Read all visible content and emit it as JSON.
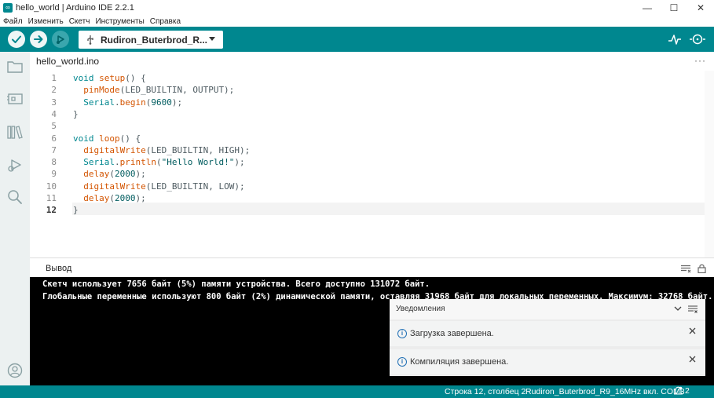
{
  "window": {
    "title": "hello_world | Arduino IDE 2.2.1",
    "controls": {
      "minimize": "—",
      "maximize": "☐",
      "close": "✕"
    }
  },
  "menu": [
    "Файл",
    "Изменить",
    "Скетч",
    "Инструменты",
    "Справка"
  ],
  "toolbar": {
    "board": "Rudiron_Buterbrod_R...",
    "icons": [
      "verify-icon",
      "upload-icon",
      "debugger-icon",
      "serial-plotter-icon",
      "serial-monitor-icon"
    ]
  },
  "sidebar": {
    "icons": [
      "sketchbook-icon",
      "boards-manager-icon",
      "library-manager-icon",
      "debug-icon",
      "search-icon",
      "account-icon"
    ]
  },
  "tab": {
    "label": "hello_world.ino",
    "more": "···"
  },
  "editor": {
    "active_line": 12,
    "lines": [
      {
        "n": "1",
        "tokens": [
          [
            "kw",
            "void "
          ],
          [
            "fn",
            "setup"
          ],
          [
            "",
            "() {"
          ]
        ]
      },
      {
        "n": "2",
        "tokens": [
          [
            "",
            "  "
          ],
          [
            "fn",
            "pinMode"
          ],
          [
            "",
            "(LED_BUILTIN, OUTPUT);"
          ]
        ]
      },
      {
        "n": "3",
        "tokens": [
          [
            "",
            "  "
          ],
          [
            "kw",
            "Serial"
          ],
          [
            "",
            "."
          ],
          [
            "fn",
            "begin"
          ],
          [
            "",
            "("
          ],
          [
            "num",
            "9600"
          ],
          [
            "",
            ");"
          ]
        ]
      },
      {
        "n": "4",
        "tokens": [
          [
            "",
            "}"
          ]
        ]
      },
      {
        "n": "5",
        "tokens": []
      },
      {
        "n": "6",
        "tokens": [
          [
            "kw",
            "void "
          ],
          [
            "fn",
            "loop"
          ],
          [
            "",
            "() {"
          ]
        ]
      },
      {
        "n": "7",
        "tokens": [
          [
            "",
            "  "
          ],
          [
            "fn",
            "digitalWrite"
          ],
          [
            "",
            "(LED_BUILTIN, HIGH);"
          ]
        ]
      },
      {
        "n": "8",
        "tokens": [
          [
            "",
            "  "
          ],
          [
            "kw",
            "Serial"
          ],
          [
            "",
            "."
          ],
          [
            "fn",
            "println"
          ],
          [
            "",
            "("
          ],
          [
            "str",
            "\"Hello World!\""
          ],
          [
            "",
            ");"
          ]
        ]
      },
      {
        "n": "9",
        "tokens": [
          [
            "",
            "  "
          ],
          [
            "fn",
            "delay"
          ],
          [
            "",
            "("
          ],
          [
            "num",
            "2000"
          ],
          [
            "",
            ");"
          ]
        ]
      },
      {
        "n": "10",
        "tokens": [
          [
            "",
            "  "
          ],
          [
            "fn",
            "digitalWrite"
          ],
          [
            "",
            "(LED_BUILTIN, LOW);"
          ]
        ]
      },
      {
        "n": "11",
        "tokens": [
          [
            "",
            "  "
          ],
          [
            "fn",
            "delay"
          ],
          [
            "",
            "("
          ],
          [
            "num",
            "2000"
          ],
          [
            "",
            ");"
          ]
        ]
      },
      {
        "n": "12",
        "tokens": [
          [
            "",
            "}"
          ]
        ]
      }
    ]
  },
  "output": {
    "title": "Вывод",
    "lines": [
      "Скетч использует 7656 байт (5%) памяти устройства. Всего доступно 131072 байт.",
      "Глобальные переменные используют 800 байт (2%) динамической памяти, оставляя 31968 байт для локальных переменных. Максимум: 32768 байт."
    ]
  },
  "notifications": {
    "title": "Уведомления",
    "items": [
      {
        "text": "Загрузка завершена."
      },
      {
        "text": "Компиляция завершена."
      }
    ]
  },
  "status": {
    "position": "Строка 12, столбец 2",
    "board": "Rudiron_Buterbrod_R9_16MHz вкл. COM3",
    "notification_count": "2"
  },
  "colors": {
    "accent": "#00878f",
    "accent_dark": "#006468",
    "sidebar": "#ecf1f1",
    "console": "#000000"
  }
}
